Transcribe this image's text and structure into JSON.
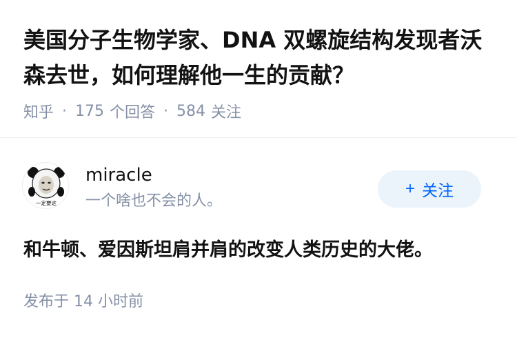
{
  "question": {
    "title": "美国分子生物学家、DNA 双螺旋结构发现者沃森去世，如何理解他一生的贡献？",
    "source": "知乎",
    "answer_count": "175",
    "answer_count_label": "个回答",
    "follower_count": "584",
    "follower_count_label": "关注"
  },
  "answer": {
    "author": {
      "name": "miracle",
      "bio": "一个啥也不会的人。",
      "avatar_caption": "一定要这",
      "avatar_icon": "panda-meme-avatar-icon"
    },
    "follow_button": {
      "plus": "+",
      "label": "关注"
    },
    "content": "和牛顿、爱因斯坦肩并肩的改变人类历史的大佬。",
    "published_time": "发布于 14 小时前"
  },
  "colors": {
    "text_primary": "#121212",
    "text_secondary": "#8590a6",
    "accent_blue": "#0066ff",
    "button_bg": "#ebf3fb"
  }
}
